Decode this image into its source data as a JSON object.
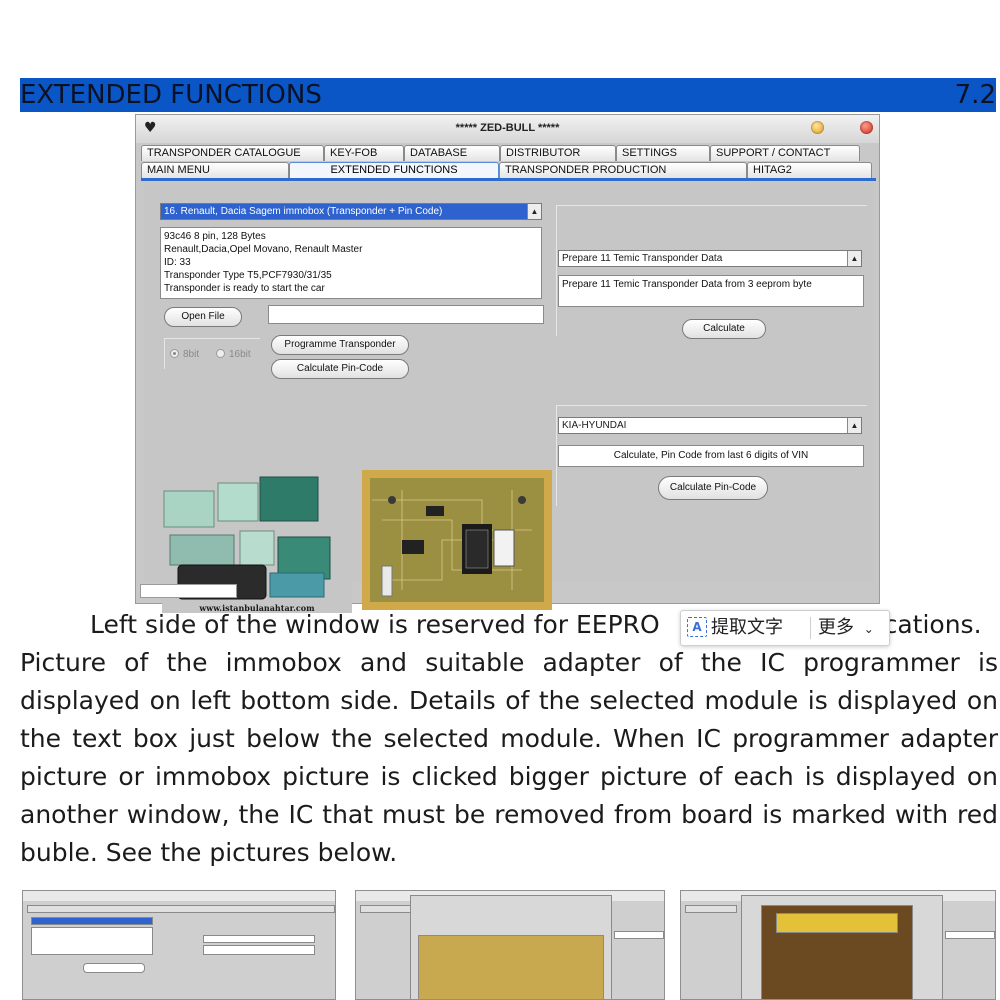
{
  "header": {
    "title": "EXTENDED FUNCTIONS",
    "section": "7.2"
  },
  "window": {
    "title": "***** ZED-BULL *****",
    "tabs_row1": [
      "TRANSPONDER CATALOGUE",
      "KEY-FOB",
      "DATABASE",
      "DISTRIBUTOR",
      "SETTINGS",
      "SUPPORT / CONTACT"
    ],
    "tabs_row2": [
      "MAIN MENU",
      "EXTENDED FUNCTIONS",
      "TRANSPONDER PRODUCTION",
      "HITAG2"
    ],
    "active_tab": "EXTENDED FUNCTIONS",
    "left": {
      "module_select": "16. Renault, Dacia Sagem immobox (Transponder + Pin Code)",
      "details": [
        "93c46 8 pin, 128 Bytes",
        "Renault,Dacia,Opel Movano, Renault Master",
        "ID: 33",
        "Transponder Type T5,PCF7930/31/35",
        "Transponder is ready to start the car"
      ],
      "open_file_button": "Open File",
      "file_path": "",
      "radio_8bit": "8bit",
      "radio_16bit": "16bit",
      "program_button": "Programme Transponder",
      "pincode_button": "Calculate Pin-Code",
      "watermark": "www.istanbulanahtar.com"
    },
    "right": {
      "function_select": "Prepare 11 Temic Transponder Data",
      "function_desc": "Prepare 11 Temic Transponder Data from 3 eeprom byte",
      "calculate_button": "Calculate",
      "brand_select": "KIA-HYUNDAI",
      "vin_hint": "Calculate, Pin Code from last 6 digits of VIN",
      "calc_pin_button": "Calculate Pin-Code"
    }
  },
  "paragraph": {
    "line1_pre": "Left side of the window is reserved for EEPRO",
    "line1_post": "lications.",
    "rest": "Picture of the immobox and suitable adapter of the IC programmer is displayed on left bottom side. Details of the selected module is displayed on the text box just below the selected module. When IC programmer adapter picture or immobox picture is clicked bigger picture of each is displayed on another window, the IC that must be removed from board is marked with red buble. See the pictures below."
  },
  "overlay": {
    "extract_label": "提取文字",
    "more_label": "更多"
  },
  "colors": {
    "header_bg": "#0b56c6",
    "selection": "#2e62cf",
    "pcb": "#d6b24a"
  }
}
